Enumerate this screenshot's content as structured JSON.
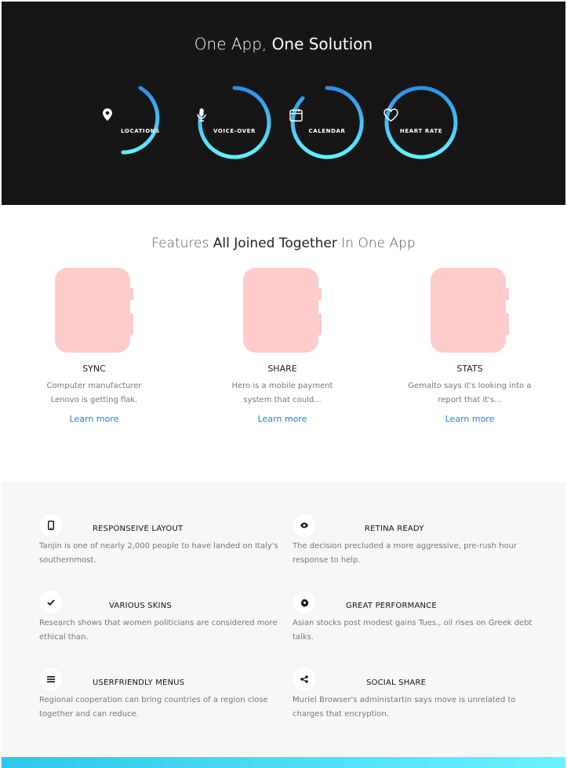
{
  "hero": {
    "title_light": "One App,",
    "title_strong": "One Solution",
    "rings": [
      {
        "label": "LOCATIONS",
        "icon": "map-pin-icon"
      },
      {
        "label": "VOICE-OVER",
        "icon": "microphone-icon"
      },
      {
        "label": "CALENDAR",
        "icon": "calendar-icon"
      },
      {
        "label": "HEART RATE",
        "icon": "heart-icon"
      }
    ],
    "ring_gradient": [
      "#2d8ee8",
      "#63f1ff"
    ]
  },
  "features": {
    "title_part1": "Features",
    "title_part2": "All Joined Together",
    "title_part3": "In One App",
    "cards": [
      {
        "name": "SYNC",
        "desc": "Computer manufacturer Lenovo is getting flak.",
        "link": "Learn more"
      },
      {
        "name": "SHARE",
        "desc": "Hero is a mobile payment system that could...",
        "link": "Learn more"
      },
      {
        "name": "STATS",
        "desc": "Gemalto says it's looking into a report that it's...",
        "link": "Learn more"
      }
    ],
    "watch_color": "#ffcccc",
    "link_color": "#2f7fc8"
  },
  "list": {
    "items": [
      {
        "title": "RESPONSEIVE LAYOUT",
        "desc": "Tanjin is one of nearly 2,000 people to have landed on Italy's southernmost.",
        "icon": "mobile-icon"
      },
      {
        "title": "RETINA READY",
        "desc": "The decision precluded a more aggressive, pre-rush hour response to help.",
        "icon": "eye-icon"
      },
      {
        "title": "VARIOUS SKINS",
        "desc": "Research shows that women politicians are considered more ethical than.",
        "icon": "check-icon"
      },
      {
        "title": "GREAT PERFORMANCE",
        "desc": "Asian stocks post modest gains Tues., oil rises on Greek debt talks.",
        "icon": "gear-icon"
      },
      {
        "title": "USERFRIENDLY MENUS",
        "desc": "Regional cooperation can bring countries of a region close together and can reduce.",
        "icon": "menu-icon"
      },
      {
        "title": "SOCIAL SHARE",
        "desc": "Muriel Browser's administartin says move is unrelated to charges that encryption.",
        "icon": "share-icon"
      }
    ]
  }
}
